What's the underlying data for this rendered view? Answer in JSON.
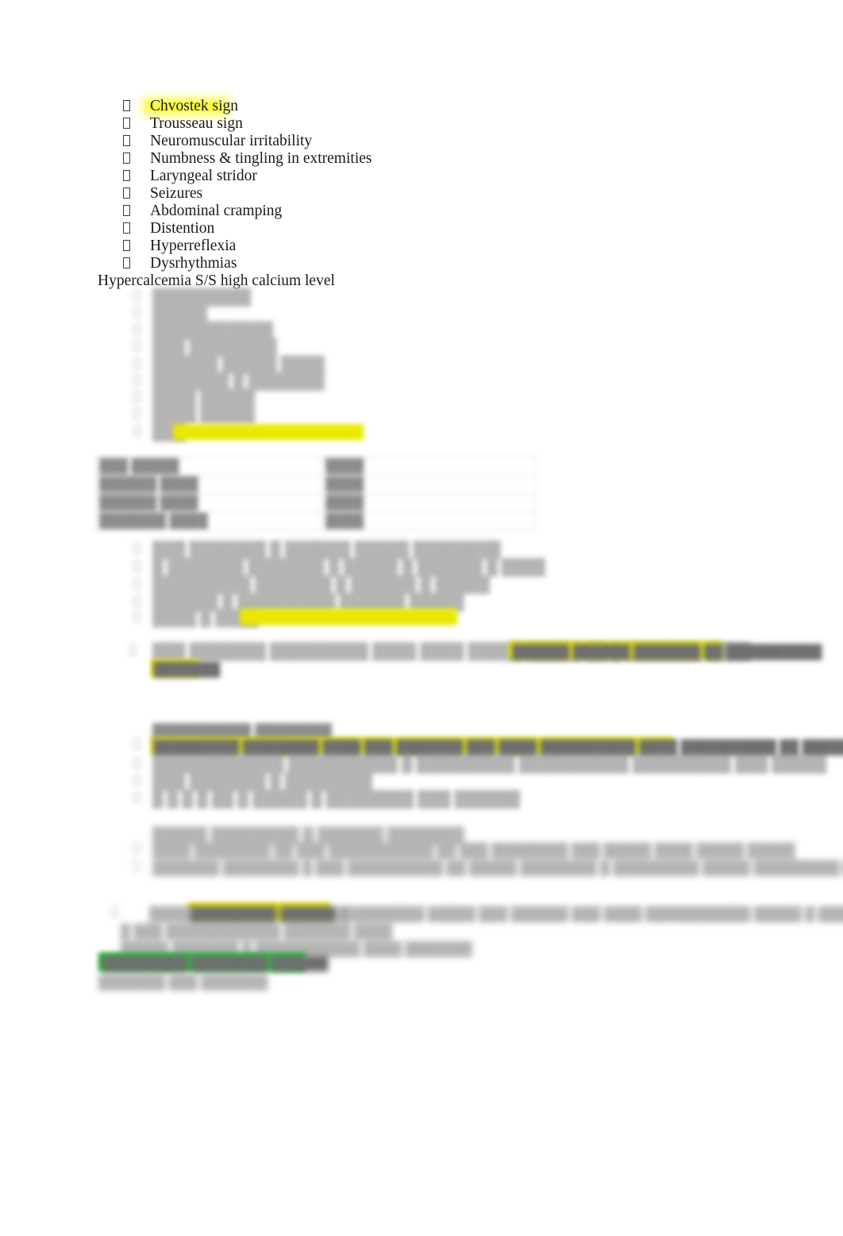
{
  "document": {
    "background_color": "#ffffff",
    "highlight_yellow": "#e9e800",
    "highlight_green": "#22bf35",
    "text_color": "#1a1a1a"
  },
  "hypocalcemia_list": {
    "bullet_glyph": "tofu-box",
    "items": [
      {
        "label": "Chvostek sign",
        "highlight": "yellow"
      },
      {
        "label": "Trousseau sign",
        "highlight": "none"
      },
      {
        "label": "Neuromuscular irritability",
        "highlight": "none"
      },
      {
        "label": "Numbness & tingling in extremities",
        "highlight": "none"
      },
      {
        "label": "Laryngeal stridor",
        "highlight": "none"
      },
      {
        "label": "Seizures",
        "highlight": "none"
      },
      {
        "label": "Abdominal cramping",
        "highlight": "none"
      },
      {
        "label": "Distention",
        "highlight": "none"
      },
      {
        "label": "Hyperreflexia",
        "highlight": "none"
      },
      {
        "label": "Dysrhythmias",
        "highlight": "none"
      }
    ]
  },
  "hypercalcemia_heading": {
    "text": "Hypercalcemia S/S high calcium level"
  },
  "hypercalcemia_list": {
    "blurred": true,
    "items": [
      {
        "text": "█████████"
      },
      {
        "text": "█████"
      },
      {
        "text": "███████████"
      },
      {
        "text": "███ ████████"
      },
      {
        "text": "██████ █████ ████"
      },
      {
        "text": "███████ █ ███████"
      },
      {
        "text": "████ █████"
      },
      {
        "text": "████ █████"
      },
      {
        "text": "███",
        "highlight": "yellow"
      }
    ]
  },
  "table": {
    "blurred": true,
    "rows": [
      {
        "cells": [
          "███ █████",
          "████"
        ]
      },
      {
        "cells": [
          "██████ ████",
          "████"
        ]
      },
      {
        "cells": [
          "██████ ████",
          "████"
        ]
      },
      {
        "cells": [
          "███████ ████",
          "████"
        ]
      }
    ]
  },
  "findings_list": {
    "blurred": true,
    "items": [
      {
        "text": "███ ███████ █ ██████ █████ ████████"
      },
      {
        "text": "█ ███████ ███████ █ █████ █ ██████ █ ████"
      },
      {
        "text": "█████████ ███████ █ ██████ █ █████"
      },
      {
        "text": "██████ █ █████████ ██████ █████"
      },
      {
        "text": "████ █ ████"
      },
      {
        "text": "███████ █ █████ █ ███████████",
        "highlight": "yellow"
      }
    ]
  },
  "paragraph_block": {
    "blurred": true,
    "lead": "███ ███████ █████████ ████ ████ █████ █████ ██ █ ███████ ████",
    "highlighted_tail": "██████ ██████ ███████ ██ ██████████",
    "wrap": "███████"
  },
  "section_a": {
    "blurred": true,
    "heading": "█████████ ███████",
    "highlight_line": "█████████ ████████ ████ ███ ███████ ███ ████ ██████████ ████ ██████████ ██ ██████ ███████",
    "items": [
      {
        "text": "████████████ ██████████ █ █████████ ██████████ █████████ ███ █████"
      },
      {
        "text": "███ ███████ █ ████████"
      },
      {
        "text": "█ █ █ █ ██ █ █████ █ ████████ ███ ██████"
      }
    ]
  },
  "section_b": {
    "blurred": true,
    "heading": "█████ ████████ █ ██████ ███████",
    "items": [
      {
        "text": "████ ████████ ██ ███ ███████████ ██ ███ ████████ ███ █████ ████ █████ █████"
      },
      {
        "text": "███████ ████████ █ ███ ██████████ ██ █████ ████████ █ █████████ █████ █████████ ██ █ ███████ ███████"
      }
    ]
  },
  "closing_block": {
    "blurred": true,
    "line1_pre": "█████",
    "line1_highlight": "█████████ ███████",
    "line1_post": "█ ████████ █████ ███ ██████ ███ ████ ███████████ █████ █ ████",
    "line2": "█ ███ ████████████ ███████ ████",
    "line3": "█████ ███████ █ ███████████ ████ ███████",
    "green_line": "█████████ ████████ ██████",
    "line4": "███████ ███ ███████"
  }
}
